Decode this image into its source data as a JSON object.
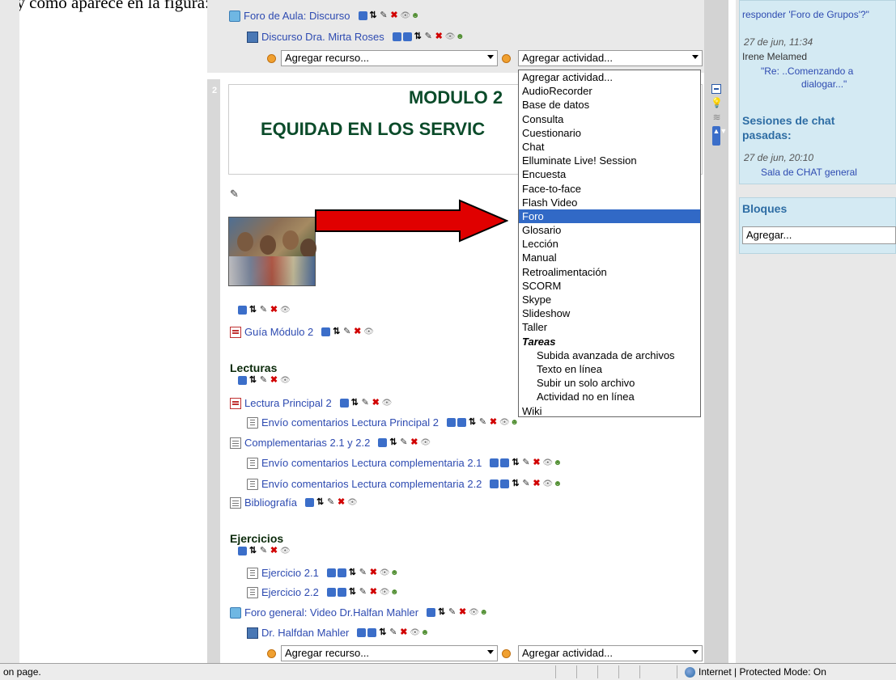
{
  "caption": "al y como aparece en la figura:",
  "section1": {
    "forum": "Foro de Aula: Discurso",
    "video": "Discurso Dra. Mirta Roses",
    "add_resource": "Agregar recurso...",
    "add_activity": "Agregar actividad..."
  },
  "section2": {
    "number": "2",
    "title_line1": "MODULO 2",
    "title_line2": "EQUIDAD EN LOS SERVIC",
    "guide": "Guía Módulo 2",
    "lecturas_heading": "Lecturas",
    "items": [
      {
        "icon": "pdf-icon",
        "label": "Lectura Principal 2"
      },
      {
        "icon": "assignment-icon",
        "label": "Envío comentarios Lectura Principal 2"
      },
      {
        "icon": "page-icon",
        "label": "Complementarias 2.1 y 2.2"
      },
      {
        "icon": "assignment-icon",
        "label": "Envío comentarios Lectura complementaria 2.1"
      },
      {
        "icon": "assignment-icon",
        "label": "Envío comentarios Lectura complementaria 2.2"
      },
      {
        "icon": "page-icon",
        "label": "Bibliografía"
      }
    ],
    "ejercicios_heading": "Ejercicios",
    "ejercicios": [
      {
        "label": "Ejercicio 2.1"
      },
      {
        "label": "Ejercicio 2.2"
      }
    ],
    "forum2": "Foro general: Video Dr.Halfan Mahler",
    "video2": "Dr. Halfdan Mahler",
    "add_resource": "Agregar recurso...",
    "add_activity": "Agregar actividad..."
  },
  "dropdown": {
    "items": [
      {
        "label": "Agregar actividad...",
        "kind": "normal"
      },
      {
        "label": "AudioRecorder",
        "kind": "normal"
      },
      {
        "label": "Base de datos",
        "kind": "normal"
      },
      {
        "label": "Consulta",
        "kind": "normal"
      },
      {
        "label": "Cuestionario",
        "kind": "normal"
      },
      {
        "label": "Chat",
        "kind": "normal"
      },
      {
        "label": "Elluminate Live! Session",
        "kind": "normal"
      },
      {
        "label": "Encuesta",
        "kind": "normal"
      },
      {
        "label": "Face-to-face",
        "kind": "normal"
      },
      {
        "label": "Flash Video",
        "kind": "normal"
      },
      {
        "label": "Foro",
        "kind": "selected"
      },
      {
        "label": "Glosario",
        "kind": "normal"
      },
      {
        "label": "Lección",
        "kind": "normal"
      },
      {
        "label": "Manual",
        "kind": "normal"
      },
      {
        "label": "Retroalimentación",
        "kind": "normal"
      },
      {
        "label": "SCORM",
        "kind": "normal"
      },
      {
        "label": "Skype",
        "kind": "normal"
      },
      {
        "label": "Slideshow",
        "kind": "normal"
      },
      {
        "label": "Taller",
        "kind": "normal"
      },
      {
        "label": "Tareas",
        "kind": "group"
      },
      {
        "label": "Subida avanzada de archivos",
        "kind": "sub"
      },
      {
        "label": "Texto en línea",
        "kind": "sub"
      },
      {
        "label": "Subir un solo archivo",
        "kind": "sub"
      },
      {
        "label": "Actividad no en línea",
        "kind": "sub"
      },
      {
        "label": "Wiki",
        "kind": "normal"
      }
    ]
  },
  "sidebar": {
    "top_link": "responder 'Foro de Grupos'?\"",
    "post_time": "27 de jun, 11:34",
    "post_author": "Irene Melamed",
    "post_text_1": "\"Re: ..Comenzando a",
    "post_text_2": "dialogar...\"",
    "chat_heading_1": "Sesiones de chat",
    "chat_heading_2": "pasadas:",
    "chat_time": "27 de jun, 20:10",
    "chat_room": "Sala de CHAT general",
    "bloques_heading": "Bloques",
    "bloques_value": "Agregar..."
  },
  "statusbar": {
    "left_text": "on page.",
    "zone_text": "Internet | Protected Mode: On"
  },
  "colors": {
    "link": "#2e4bb1",
    "module_title": "#0b4b2a",
    "selection": "#3169c6",
    "arrow": "#e00000",
    "sidebar_block": "#d4eaf3"
  }
}
